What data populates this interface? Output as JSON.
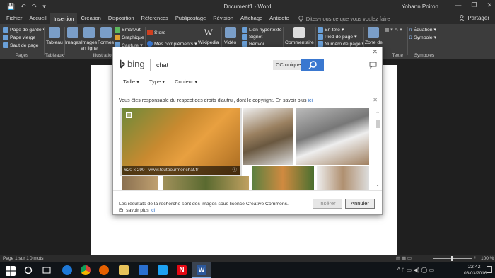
{
  "titlebar": {
    "title": "Document1 - Word",
    "user": "Yohann Poiron",
    "quick_access": [
      "💾",
      "↶",
      "↷",
      "▾"
    ],
    "window_controls": [
      "—",
      "❐",
      "✕"
    ]
  },
  "menu": {
    "tabs": [
      "Fichier",
      "Accueil",
      "Insertion",
      "Création",
      "Disposition",
      "Références",
      "Publipostage",
      "Révision",
      "Affichage",
      "Antidote"
    ],
    "active_tab": "Insertion",
    "tell_me_placeholder": "Dites-nous ce que vous voulez faire",
    "share_label": "Partager"
  },
  "ribbon": {
    "pages": {
      "items": [
        "Page de garde",
        "Page vierge",
        "Saut de page"
      ],
      "group": "Pages"
    },
    "tables": {
      "item": "Tableau",
      "group": "Tableaux"
    },
    "illustrations": {
      "items": [
        "Images",
        "Images en ligne",
        "Formes",
        "SmartArt",
        "Graphique",
        "Capture"
      ],
      "group": "Illustrations"
    },
    "addins": {
      "store": "Store",
      "mine": "Mes compléments"
    },
    "wikipedia": "Wikipedia",
    "video": "Vidéo",
    "links": {
      "items": [
        "Lien hypertexte",
        "Signet",
        "Renvoi"
      ]
    },
    "comment": "Commentaire",
    "header_footer": {
      "items": [
        "En-tête",
        "Pied de page",
        "Numéro de page"
      ]
    },
    "text": {
      "item": "Zone de",
      "group": "Texte"
    },
    "symbols": {
      "items": [
        "Équation",
        "Symbole"
      ],
      "group": "Symboles"
    }
  },
  "status": {
    "page": "Page 1 sur 1",
    "words": "0 mots",
    "zoom": "100 %"
  },
  "taskbar": {
    "time": "22:42",
    "date": "08/03/2016"
  },
  "dialog": {
    "close": "✕",
    "brand": "bing",
    "search_value": "chat",
    "license_filter": "CC uniquement",
    "filters": [
      "Taille",
      "Type",
      "Couleur"
    ],
    "notice_text": "Vous êtes responsable du respect des droits d'autrui, dont le copyright. En savoir plus",
    "notice_link": "ici",
    "hover_info": "620 x 290 · www.toutpourmonchat.fr",
    "footer_text": "Les résultats de la recherche sont des images sous licence Creative Commons. En savoir plus",
    "footer_link": "ici",
    "insert_label": "Insérer",
    "cancel_label": "Annuler"
  },
  "colors": {
    "accent": "#3a78d0",
    "word_blue": "#2b579a",
    "ribbon_bg": "#3c3c3c"
  }
}
